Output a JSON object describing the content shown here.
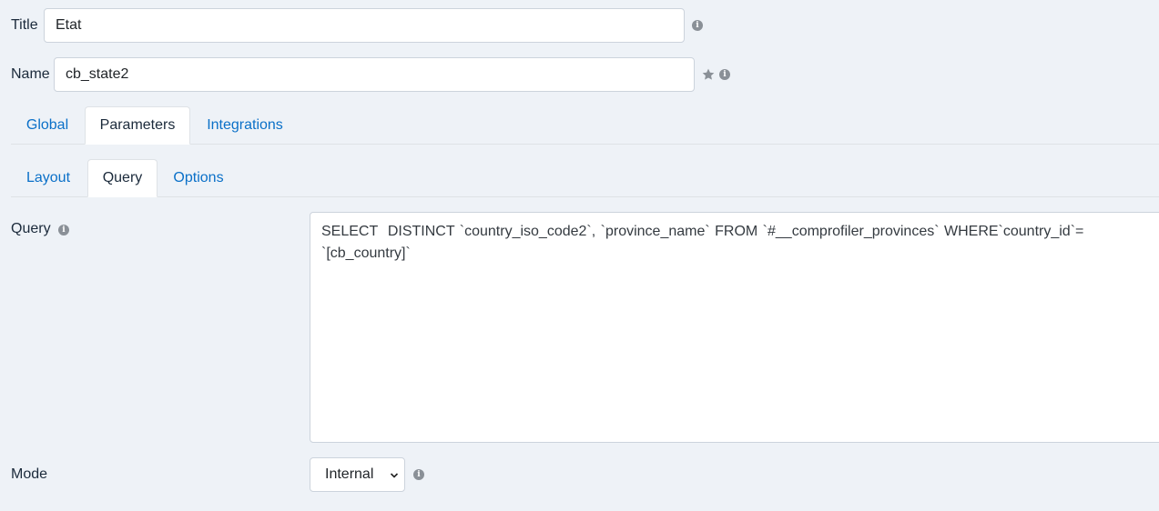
{
  "fields": {
    "title": {
      "label": "Title",
      "value": "Etat"
    },
    "name": {
      "label": "Name",
      "value": "cb_state2"
    }
  },
  "main_tabs": [
    {
      "label": "Global",
      "active": false
    },
    {
      "label": "Parameters",
      "active": true
    },
    {
      "label": "Integrations",
      "active": false
    }
  ],
  "sub_tabs": [
    {
      "label": "Layout",
      "active": false
    },
    {
      "label": "Query",
      "active": true
    },
    {
      "label": "Options",
      "active": false
    }
  ],
  "query": {
    "label": "Query",
    "value": "SELECT  DISTINCT `country_iso_code2`, `province_name` FROM `#__comprofiler_provinces` WHERE`country_id`=\n`[cb_country]`"
  },
  "mode": {
    "label": "Mode",
    "selected": "Internal"
  },
  "icons": {
    "info": "info-circle-icon",
    "star": "star-icon",
    "dropdown": "chevron-down-icon"
  },
  "colors": {
    "background": "#eef2f7",
    "link": "#0a70c8",
    "text": "#1b2a3b",
    "icon": "#8a9097"
  }
}
